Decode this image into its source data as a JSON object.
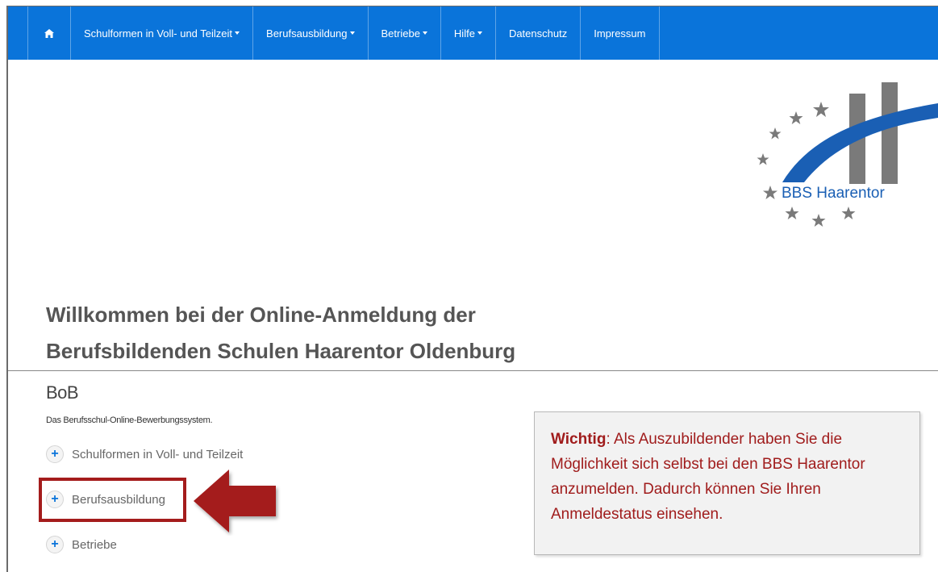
{
  "nav": {
    "home_icon": "home-icon",
    "items": [
      {
        "label": "Schulformen in Voll- und Teilzeit",
        "dropdown": true
      },
      {
        "label": "Berufsausbildung",
        "dropdown": true
      },
      {
        "label": "Betriebe",
        "dropdown": true
      },
      {
        "label": "Hilfe",
        "dropdown": true
      },
      {
        "label": "Datenschutz",
        "dropdown": false
      },
      {
        "label": "Impressum",
        "dropdown": false
      }
    ]
  },
  "logo": {
    "text": "BBS Haarentor"
  },
  "welcome": {
    "line1": "Willkommen bei der Online-Anmeldung der",
    "line2": "Berufsbildenden Schulen Haarentor Oldenburg"
  },
  "bob": {
    "title": "BoB",
    "subtitle": "Das Berufsschul-Online-Bewerbungssystem.",
    "items": [
      {
        "label": "Schulformen in Voll- und Teilzeit"
      },
      {
        "label": "Berufsausbildung"
      },
      {
        "label": "Betriebe"
      }
    ]
  },
  "info": {
    "strong": "Wichtig",
    "text": ": Als Auszubildender haben Sie die Möglichkeit sich selbst bei den BBS Haarentor anzumelden. Dadurch können Sie Ihren Anmeldestatus einsehen."
  },
  "colors": {
    "nav_bg": "#0a74da",
    "accent_red": "#a41c1c",
    "logo_blue": "#1a5fb4",
    "logo_gray": "#7a7a7a"
  }
}
